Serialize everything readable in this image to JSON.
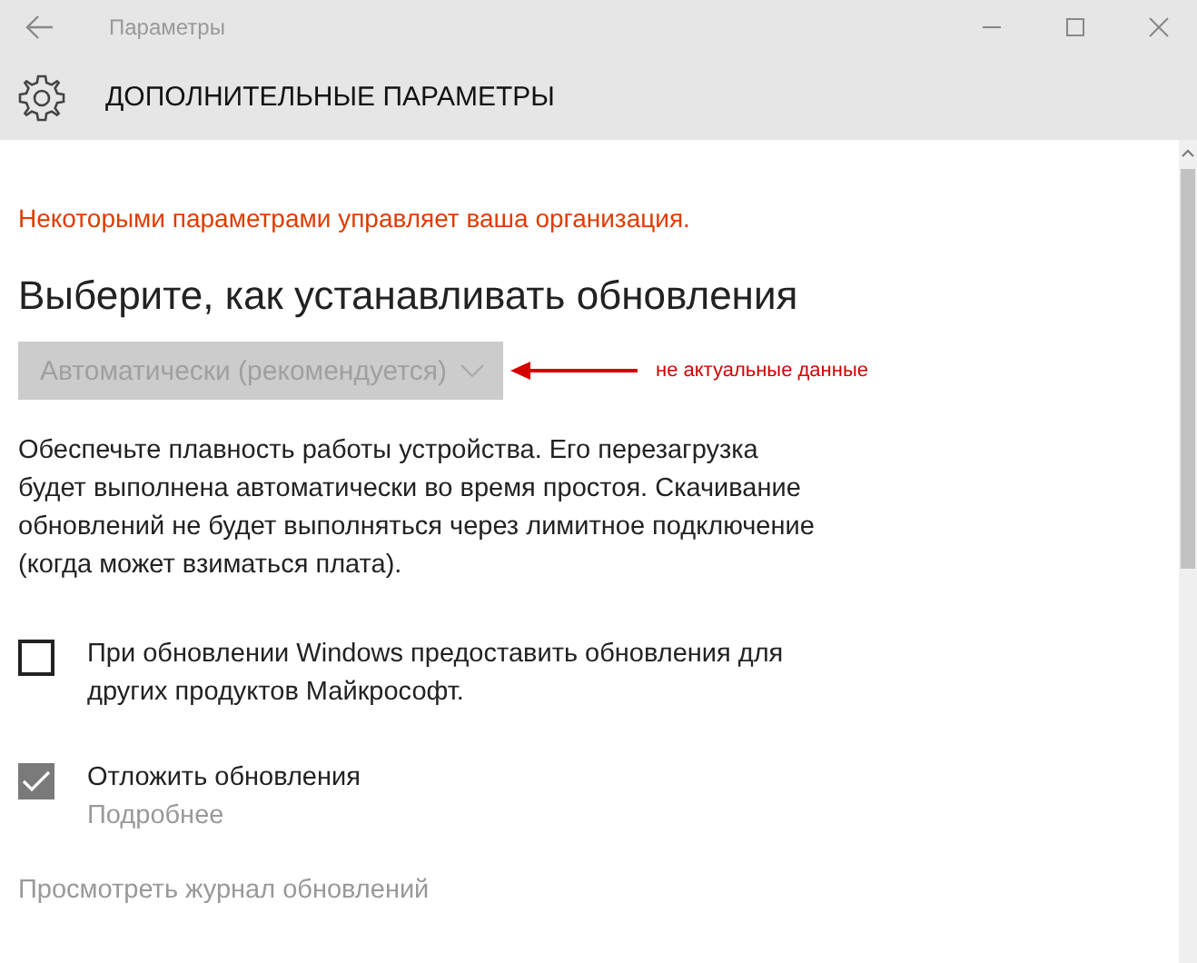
{
  "window": {
    "title": "Параметры"
  },
  "header": {
    "title": "ДОПОЛНИТЕЛЬНЫЕ ПАРАМЕТРЫ"
  },
  "notice": "Некоторыми параметрами управляет ваша организация.",
  "heading": "Выберите, как устанавливать обновления",
  "dropdown": {
    "value": "Автоматически (рекомендуется)",
    "disabled": true
  },
  "annotation": "не актуальные данные",
  "description": "Обеспечьте плавность работы устройства. Его перезагрузка будет выполнена автоматически во время простоя. Скачивание обновлений не будет выполняться через лимитное подключение (когда может взиматься плата).",
  "checkboxes": [
    {
      "label": "При обновлении Windows предоставить обновления для других продуктов Майкрософт.",
      "checked": false,
      "disabled": false
    },
    {
      "label": "Отложить обновления",
      "checked": true,
      "disabled": true,
      "link": "Подробнее"
    }
  ],
  "history_link": "Просмотреть журнал обновлений"
}
